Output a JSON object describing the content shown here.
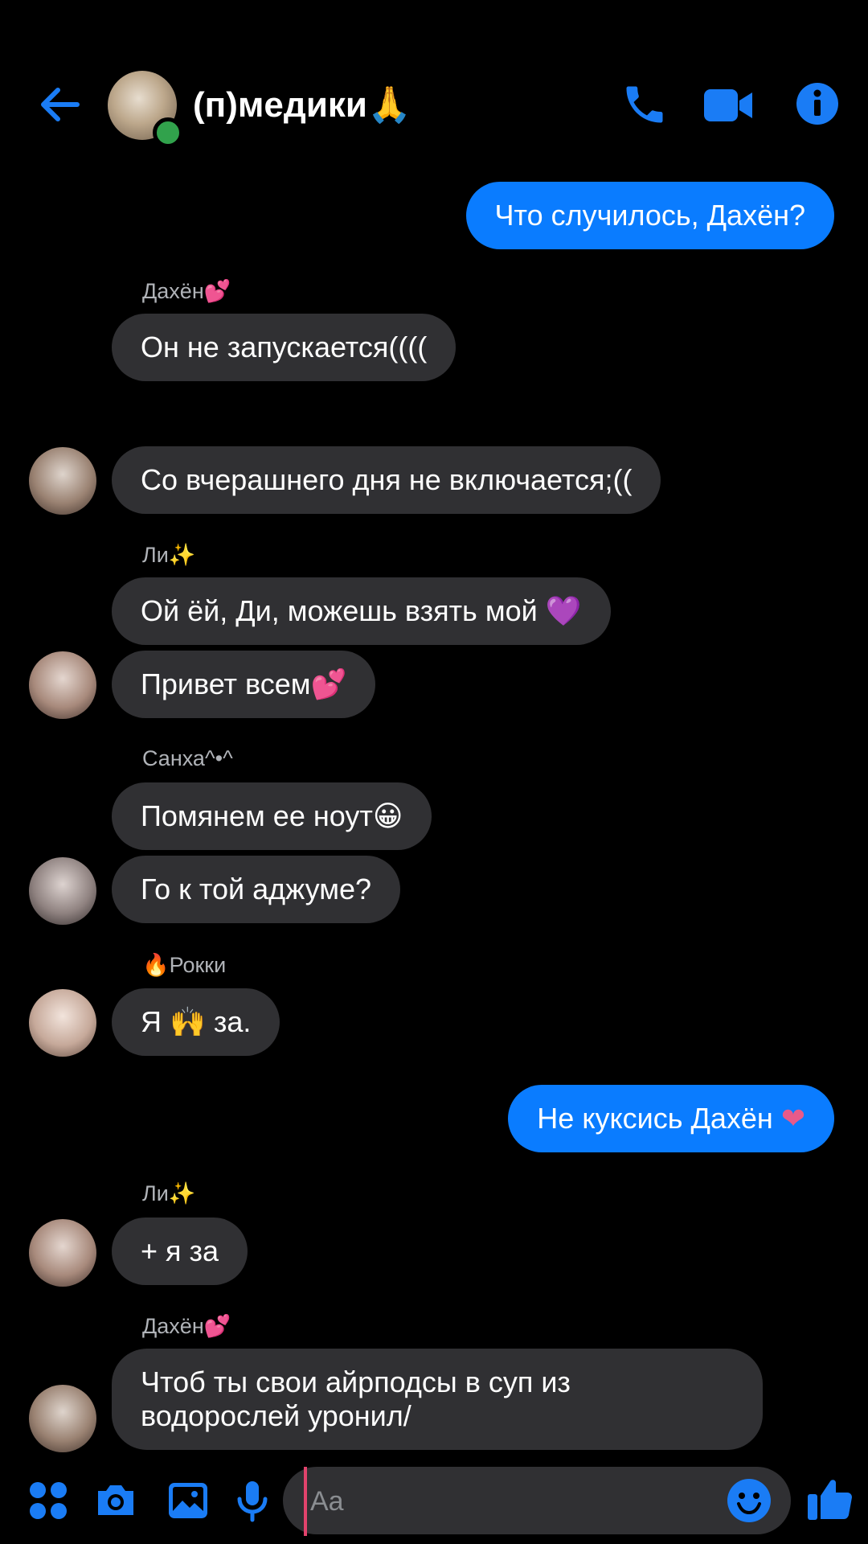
{
  "header": {
    "title": "(п)медики🙏",
    "icons": [
      "back-arrow-icon",
      "phone-icon",
      "video-camera-icon",
      "info-icon"
    ],
    "online": true
  },
  "messages": [
    {
      "type": "out",
      "text": "Что случилось, Дахён?"
    },
    {
      "type": "in",
      "sender": "Дахён💕",
      "text": "Он не запускается(((("
    },
    {
      "type": "in",
      "text": "Со вчерашнего дня не включается;(("
    },
    {
      "type": "in",
      "sender": "Ли✨",
      "text": "Ой ёй, Ди, можешь взять мой"
    },
    {
      "type": "in",
      "text": "Привет всем💕"
    },
    {
      "type": "in",
      "sender": "Санха^•^",
      "text": "Помянем ее ноут😀"
    },
    {
      "type": "in",
      "text": "Го к той аджуме?"
    },
    {
      "type": "in",
      "sender": "🔥Рокки",
      "text": "Я 🙌 за."
    },
    {
      "type": "out",
      "text": "Не куксись Дахён"
    },
    {
      "type": "in",
      "sender": "Ли✨",
      "text": "+ я за"
    },
    {
      "type": "in",
      "sender": "Дахён💕",
      "text": "Чтоб ты свои айрподсы в суп из водорослей уронил/"
    }
  ],
  "composer": {
    "placeholder": "Aa",
    "icons": [
      "apps-menu-icon",
      "camera-icon",
      "gallery-icon",
      "microphone-icon",
      "emoji-icon",
      "thumbs-up-icon"
    ]
  },
  "colors": {
    "accent": "#0a7cff",
    "incoming_bubble": "#303033",
    "background": "#000000"
  }
}
